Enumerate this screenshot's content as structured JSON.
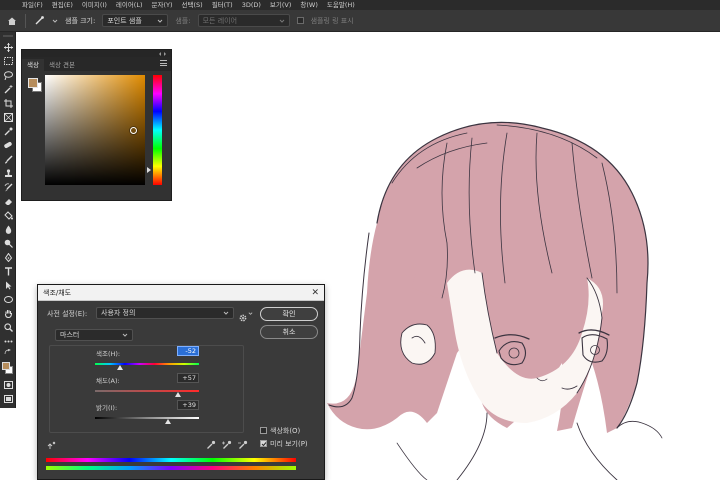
{
  "menubar": {
    "items": [
      "파일(F)",
      "편집(E)",
      "이미지(I)",
      "레이어(L)",
      "문자(Y)",
      "선택(S)",
      "필터(T)",
      "3D(D)",
      "보기(V)",
      "창(W)",
      "도움말(H)"
    ]
  },
  "options": {
    "sample_size_label": "샘플 크기:",
    "sample_size_value": "포인트 샘플",
    "sample_label": "샘플:",
    "sample_value": "모든 레이어",
    "show_ring_label": "샘플링 링 표시"
  },
  "color_panel": {
    "tabs": [
      "색상",
      "색상 견본"
    ],
    "foreground_color": "#b68d5c",
    "background_color": "#ffffff"
  },
  "dialog": {
    "title": "색조/채도",
    "preset_label": "사전 설정(E):",
    "preset_value": "사용자 정의",
    "channel_value": "마스터",
    "hue_label": "색조(H):",
    "hue_value": "-52",
    "saturation_label": "채도(A):",
    "saturation_value": "+57",
    "lightness_label": "밝기(I):",
    "lightness_value": "+39",
    "ok_label": "확인",
    "cancel_label": "취소",
    "colorize_label": "색상화(O)",
    "colorize_checked": false,
    "preview_label": "미리 보기(P)",
    "preview_checked": true
  },
  "colors": {
    "hair": "#d4a3ab",
    "line": "#3b3440",
    "ui_dark": "#323232"
  }
}
